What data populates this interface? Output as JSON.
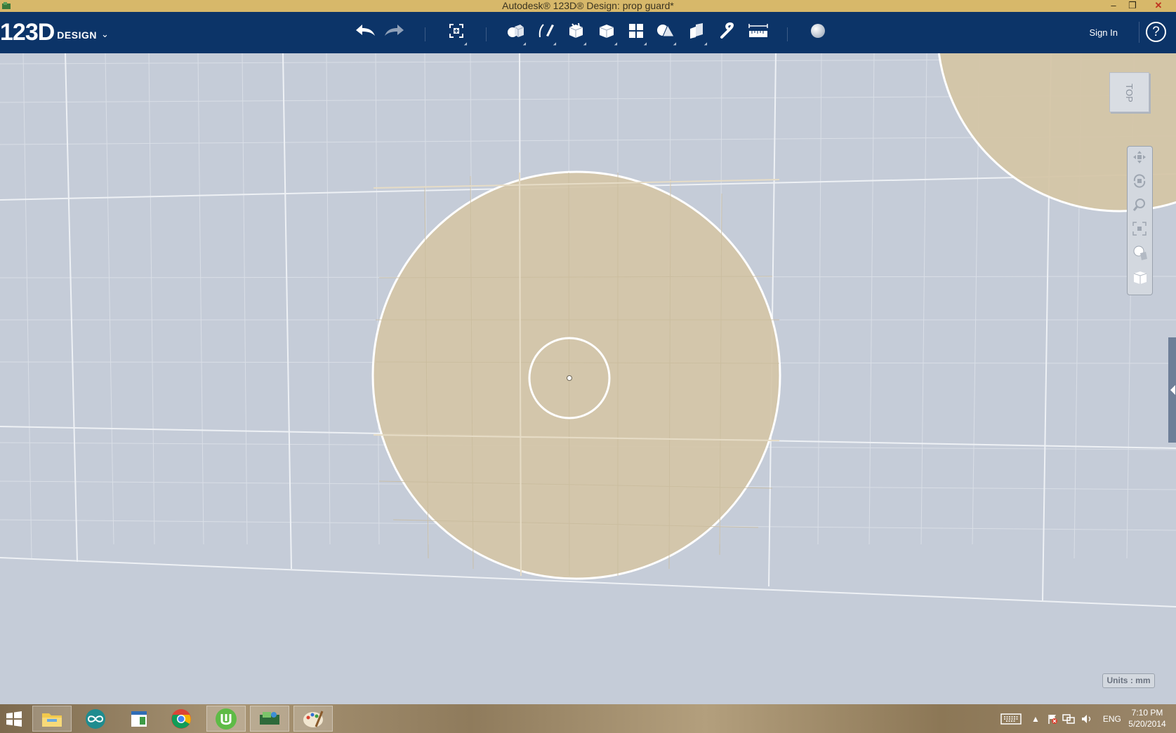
{
  "window": {
    "title": "Autodesk® 123D® Design: prop guard*",
    "minimize_glyph": "–",
    "restore_glyph": "❐",
    "close_glyph": "✕"
  },
  "toolbar": {
    "logo_big": "123D",
    "logo_small": "DESIGN",
    "logo_menu_glyph": "⌄",
    "signin_label": "Sign In",
    "help_glyph": "?",
    "tools": [
      {
        "name": "undo-icon"
      },
      {
        "name": "redo-icon"
      },
      {
        "name": "transform-icon"
      },
      {
        "name": "primitives-icon"
      },
      {
        "name": "sketch-icon"
      },
      {
        "name": "construct-icon"
      },
      {
        "name": "modify-icon"
      },
      {
        "name": "pattern-icon"
      },
      {
        "name": "grouping-icon"
      },
      {
        "name": "combine-icon"
      },
      {
        "name": "snap-icon"
      },
      {
        "name": "measure-icon"
      },
      {
        "name": "material-icon"
      }
    ]
  },
  "viewport": {
    "viewcube_label": "TOP",
    "units_label": "Units : mm",
    "disc_color": "#d4c5a7",
    "grid_color": "#e3e8ef",
    "nav_tools": [
      "pan-icon",
      "orbit-icon",
      "zoom-icon",
      "fit-icon",
      "visual-style-icon",
      "material-view-icon"
    ]
  },
  "taskbar": {
    "apps": [
      "windows-start-icon",
      "file-explorer-icon",
      "arduino-icon",
      "notepad-icon",
      "chrome-icon",
      "utorrent-icon",
      "123d-design-icon",
      "paint-icon"
    ],
    "language": "ENG",
    "time": "7:10 PM",
    "date": "5/20/2014"
  }
}
